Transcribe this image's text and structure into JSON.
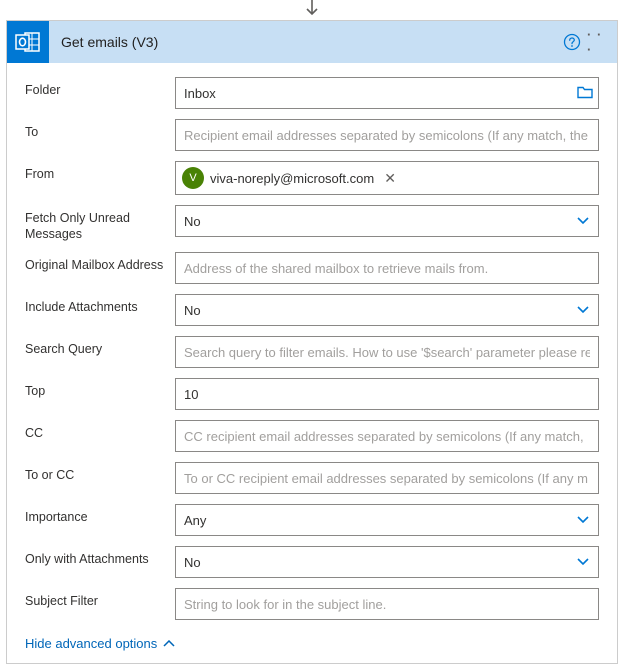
{
  "header": {
    "title": "Get emails (V3)"
  },
  "fields": {
    "folder_label": "Folder",
    "folder_value": "Inbox",
    "to_label": "To",
    "to_placeholder": "Recipient email addresses separated by semicolons (If any match, the",
    "from_label": "From",
    "from_chip_initial": "V",
    "from_chip_text": "viva-noreply@microsoft.com",
    "fetch_unread_label": "Fetch Only Unread Messages",
    "fetch_unread_value": "No",
    "orig_mailbox_label": "Original Mailbox Address",
    "orig_mailbox_placeholder": "Address of the shared mailbox to retrieve mails from.",
    "include_attach_label": "Include Attachments",
    "include_attach_value": "No",
    "search_label": "Search Query",
    "search_placeholder": "Search query to filter emails. How to use '$search' parameter please refer to: htt",
    "top_label": "Top",
    "top_value": "10",
    "cc_label": "CC",
    "cc_placeholder": "CC recipient email addresses separated by semicolons (If any match,",
    "toorcc_label": "To or CC",
    "toorcc_placeholder": "To or CC recipient email addresses separated by semicolons (If any m",
    "importance_label": "Importance",
    "importance_value": "Any",
    "only_attach_label": "Only with Attachments",
    "only_attach_value": "No",
    "subject_label": "Subject Filter",
    "subject_placeholder": "String to look for in the subject line."
  },
  "footer": {
    "toggle_text": "Hide advanced options"
  }
}
